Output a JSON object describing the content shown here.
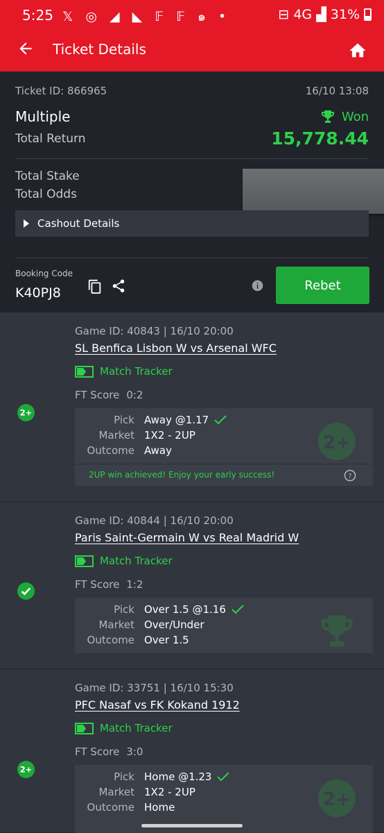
{
  "status_bar": {
    "time": "5:25",
    "notif_icons": "𝕏 ◎ ◢ ◣ 𝔽 𝔽 ๑ •",
    "signal": "4G",
    "battery": "31%"
  },
  "app_bar": {
    "title": "Ticket Details"
  },
  "ticket": {
    "id_label": "Ticket ID: 866965",
    "date": "16/10 13:08",
    "type": "Multiple",
    "status": "Won",
    "total_return_label": "Total Return",
    "total_return": "15,778.44",
    "total_stake_label": "Total Stake",
    "total_odds_label": "Total Odds",
    "cashout_label": "Cashout Details",
    "booking_code_label": "Booking Code",
    "booking_code": "K40PJ8",
    "rebet_label": "Rebet"
  },
  "bets": [
    {
      "game": "Game ID: 40843 | 16/10 20:00",
      "match": "SL Benfica Lisbon W vs Arsenal WFC",
      "tracker": "Match Tracker",
      "ft_label": "FT Score",
      "ft_score": "0:2",
      "pick_label": "Pick",
      "pick": "Away @1.17",
      "market_label": "Market",
      "market": "1X2 - 2UP",
      "outcome_label": "Outcome",
      "outcome": "Away",
      "badge": "2UP",
      "note": "2UP win achieved! Enjoy your early success!"
    },
    {
      "game": "Game ID: 40844 | 16/10 20:00",
      "match": "Paris Saint-Germain W vs Real Madrid W",
      "tracker": "Match Tracker",
      "ft_label": "FT Score",
      "ft_score": "1:2",
      "pick_label": "Pick",
      "pick": "Over 1.5 @1.16",
      "market_label": "Market",
      "market": "Over/Under",
      "outcome_label": "Outcome",
      "outcome": "Over 1.5",
      "badge": "won"
    },
    {
      "game": "Game ID: 33751 | 16/10 15:30",
      "match": "PFC Nasaf vs FK Kokand 1912",
      "tracker": "Match Tracker",
      "ft_label": "FT Score",
      "ft_score": "3:0",
      "pick_label": "Pick",
      "pick": "Home @1.23",
      "market_label": "Market",
      "market": "1X2 - 2UP",
      "outcome_label": "Outcome",
      "outcome": "Home",
      "badge": "2UP"
    }
  ],
  "colors": {
    "brand_red": "#e41827",
    "won_green": "#2fd04a",
    "rebet_green": "#1fa83a",
    "bg_dark": "#202329",
    "bg_card": "#31353e"
  }
}
